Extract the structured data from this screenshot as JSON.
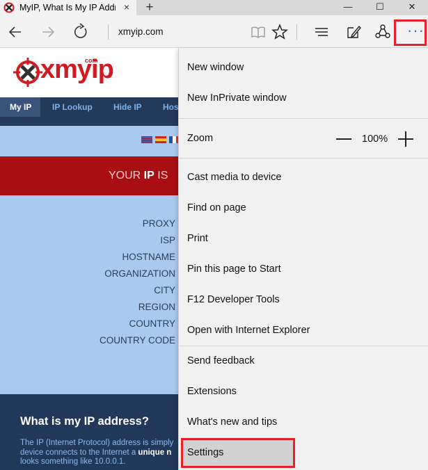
{
  "tab": {
    "title": "MyIP, What Is My IP Address",
    "close_glyph": "×",
    "new_tab_glyph": "+"
  },
  "window_controls": {
    "minimize": "—",
    "maximize": "☐",
    "close": "✕"
  },
  "toolbar": {
    "address": "xmyip.com",
    "icons": [
      "back-icon",
      "forward-icon",
      "refresh-icon",
      "reading-view-icon",
      "favorite-star-icon",
      "hub-icon",
      "web-note-icon",
      "share-icon",
      "more-icon"
    ],
    "more_glyph": "···",
    "highlight_color": "#e8202a"
  },
  "page": {
    "logo": {
      "text": "xmyip",
      "com": "com"
    },
    "nav": [
      "My IP",
      "IP Lookup",
      "Hide IP",
      "Hos"
    ],
    "banner": {
      "prefix": "YOUR ",
      "bold": "IP",
      "suffix": " IS"
    },
    "fields": [
      "PROXY",
      "ISP",
      "HOSTNAME",
      "ORGANIZATION",
      "CITY",
      "REGION",
      "COUNTRY",
      "COUNTRY CODE"
    ],
    "footer": {
      "heading": "What is my IP address?",
      "line1": "The IP (Internet Protocol) address is simply",
      "line2_prefix": "device connects to the Internet a ",
      "line2_bold": "unique n",
      "line3": "looks something like 10.0.0.1."
    }
  },
  "menu": {
    "items": [
      "New window",
      "New InPrivate window",
      "Zoom",
      "Cast media to device",
      "Find on page",
      "Print",
      "Pin this page to Start",
      "F12 Developer Tools",
      "Open with Internet Explorer",
      "Send feedback",
      "Extensions",
      "What's new and tips",
      "Settings"
    ],
    "zoom_value": "100%"
  }
}
